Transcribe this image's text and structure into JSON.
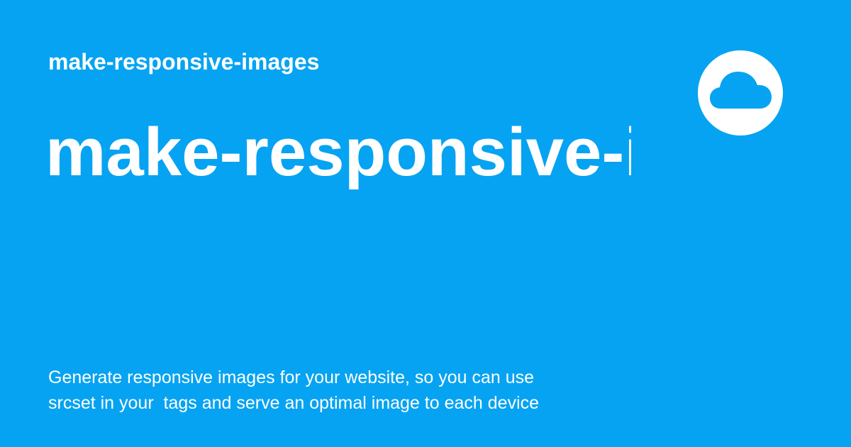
{
  "header": {
    "small_title": "make-responsive-images",
    "large_title": "make-responsive-images"
  },
  "description": {
    "line_1": "Generate responsive images for your website, so you can use",
    "line_2": "srcset in your  tags and serve an optimal image to each device"
  },
  "logo": {
    "icon": "cloud-icon"
  },
  "colors": {
    "background": "#06a3f2",
    "text": "#ffffff"
  }
}
